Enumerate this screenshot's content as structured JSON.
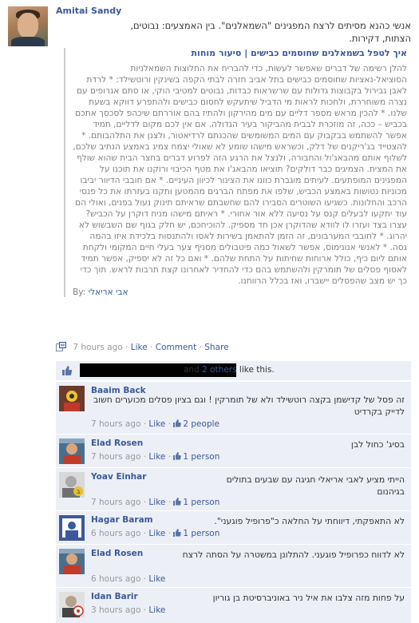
{
  "post": {
    "author": "Amitai Sandy",
    "status_line1": "אנשי כהנא מסיתים לרצח המפגינים \"השמאלנים\". בין האמצעים: נבוטים,",
    "status_line2": "הצתות, דקירות.",
    "share_title": "איך לטפל בשמאלנים שחוסמים כבישים | סיעור מוחות",
    "share_body": "להלן רשימה של דברים שאפשר לעשות, כדי להבריח את החלוצות השמאלניות הסוציאל-נאציות שחוסמים כבישים בתל אביב חזרה לבתי הקפה בשינקין ורוטשילד: * לרדת לאבן גבירול בקבוצות גדולות עם שרשראות כבדות, נבוטים למטיבי הוקי, או סתם אגרופים עם נצרה משוחררת, ולחכות לראות מי הדביל שיתעקש לחסום כבישים ולהתפרע דווקא בשעת שלנו. * להכין מראש מספר דליים עם מים מהירקון ולהתיז בהם אוררתם שיכהפ לסכסך אתכם בכביש – ככה, זה מוזכרת לבבית מהביקור בעיר הגדולה. אם אין לכם מקום לדליים, תמיד אפשר להשתמש בבקבוק עם המים המשומשים שהכנתם לרדיאטור, ולצנן את התלהבותם. * להצטייד בג'ריקנים של דלק, וכשראש מישהו שומע לא שאולי יצמח צמיג באמצע הנתיב שלכם, לשלוף אותם מהבאג'ול והחבורה, ולנצל את הרגע הזה לפרוע דברים בחצר הבית שהוא שולף את המצית. הצמיגים כבר דולקים? תוציאו מהבאג'ו את מטף הכיבוי ורוקנו את תוכנו על המפגינים המופתעים. לעיתים מוגברת כוונו את הצינור לכיוון העיניים. * אם חובבי הדיוור יביבו מכוניות נטושות באמצע הכביש, שלפו את מפתח הברגים מהמטען ותקנו בעזרתו את כל פנסי הרכב והחלונות. כשגיעו השוטרים הסבירו להם שחשבתם שראיתם תינוק נעול בפנים, ואולי הם עוד יתקעו לבעלים קנס על נסיעה ללא אור אחורי. * ראיתם מישהו מניח דוקרן על הכביש? עצרו בצד ועזרו לו לוודא שהדוקרן אכן חד מספיק. להוכיחכם, יש חלק בגוף שם השבשוש לא יהרוג. * לחובבי המערבונים, זה הזמן להתאמן בשירות לאסו ולהתנסות בלכידת איזו בהמה גסה. * לאנשי אנונימוס, אפשר לשאול כמה פיטבולים מסניף צער בעלי חיים המקומי ולקחת אותם ליום כיף, כולל ארוחות שחיתות על התחת שלהם. * ואם כל זה לא יספיק, אפשר תמיד לאסוף פסלים של תומרקין ולהשתמש בהם כדי להחדיר לאחרונו קצת תרבות לראש. תוך כדי כך יש מצב שהפסלים יישברו, ואז בכלל הרווחנו.",
    "share_by_prefix": "By:",
    "share_by_name": "אבי אריאלי",
    "time": "7 hours ago",
    "sep": "·",
    "like_label": "Like",
    "comment_label": "Comment",
    "share_label": "Share",
    "likes_suffix_and": "and",
    "likes_others": "2 others",
    "likes_tail": "like this."
  },
  "comments": [
    {
      "name": "Baaim Back",
      "text": "זה פסל של קדישמן בקצה רוטשילד ולא של תומרקין ! וגם בציון פסלים מכוערים חשוב לדייק בקרדיט",
      "time": "7 hours ago",
      "like": "Like",
      "likes": "2 people"
    },
    {
      "name": "Elad Rosen",
      "text": "בסיג' כחול לבן",
      "time": "7 hours ago",
      "like": "Like",
      "likes": "1 person"
    },
    {
      "name": "Yoav Einhar",
      "text": "הייתי מציע לאבי אריאלי חגיגה עם שבעים בתולים בגיהנום",
      "time": "7 hours ago",
      "like": "Like",
      "likes": "1 person"
    },
    {
      "name": "Hagar Baram",
      "text": "לא התאפקתי, דיווחתי על החלאה כ\"פרופיל פוגעני\".",
      "time": "6 hours ago",
      "like": "Like",
      "likes": "1 person"
    },
    {
      "name": "Elad Rosen",
      "text": "לא לדווח כפרופיל פוגעני. להתלונן במשטרה על הסתה לרצח",
      "time": "6 hours ago",
      "like": "Like",
      "likes": ""
    },
    {
      "name": "Idan Barir",
      "text": "על פחות מזה צלבו את איל ניר באוניברסיטת בן גוריון",
      "time": "3 hours ago",
      "like": "Like",
      "likes": ""
    }
  ],
  "colors": {
    "link": "#3b5998",
    "muted": "#999999",
    "comment_bg": "#eceff5"
  }
}
